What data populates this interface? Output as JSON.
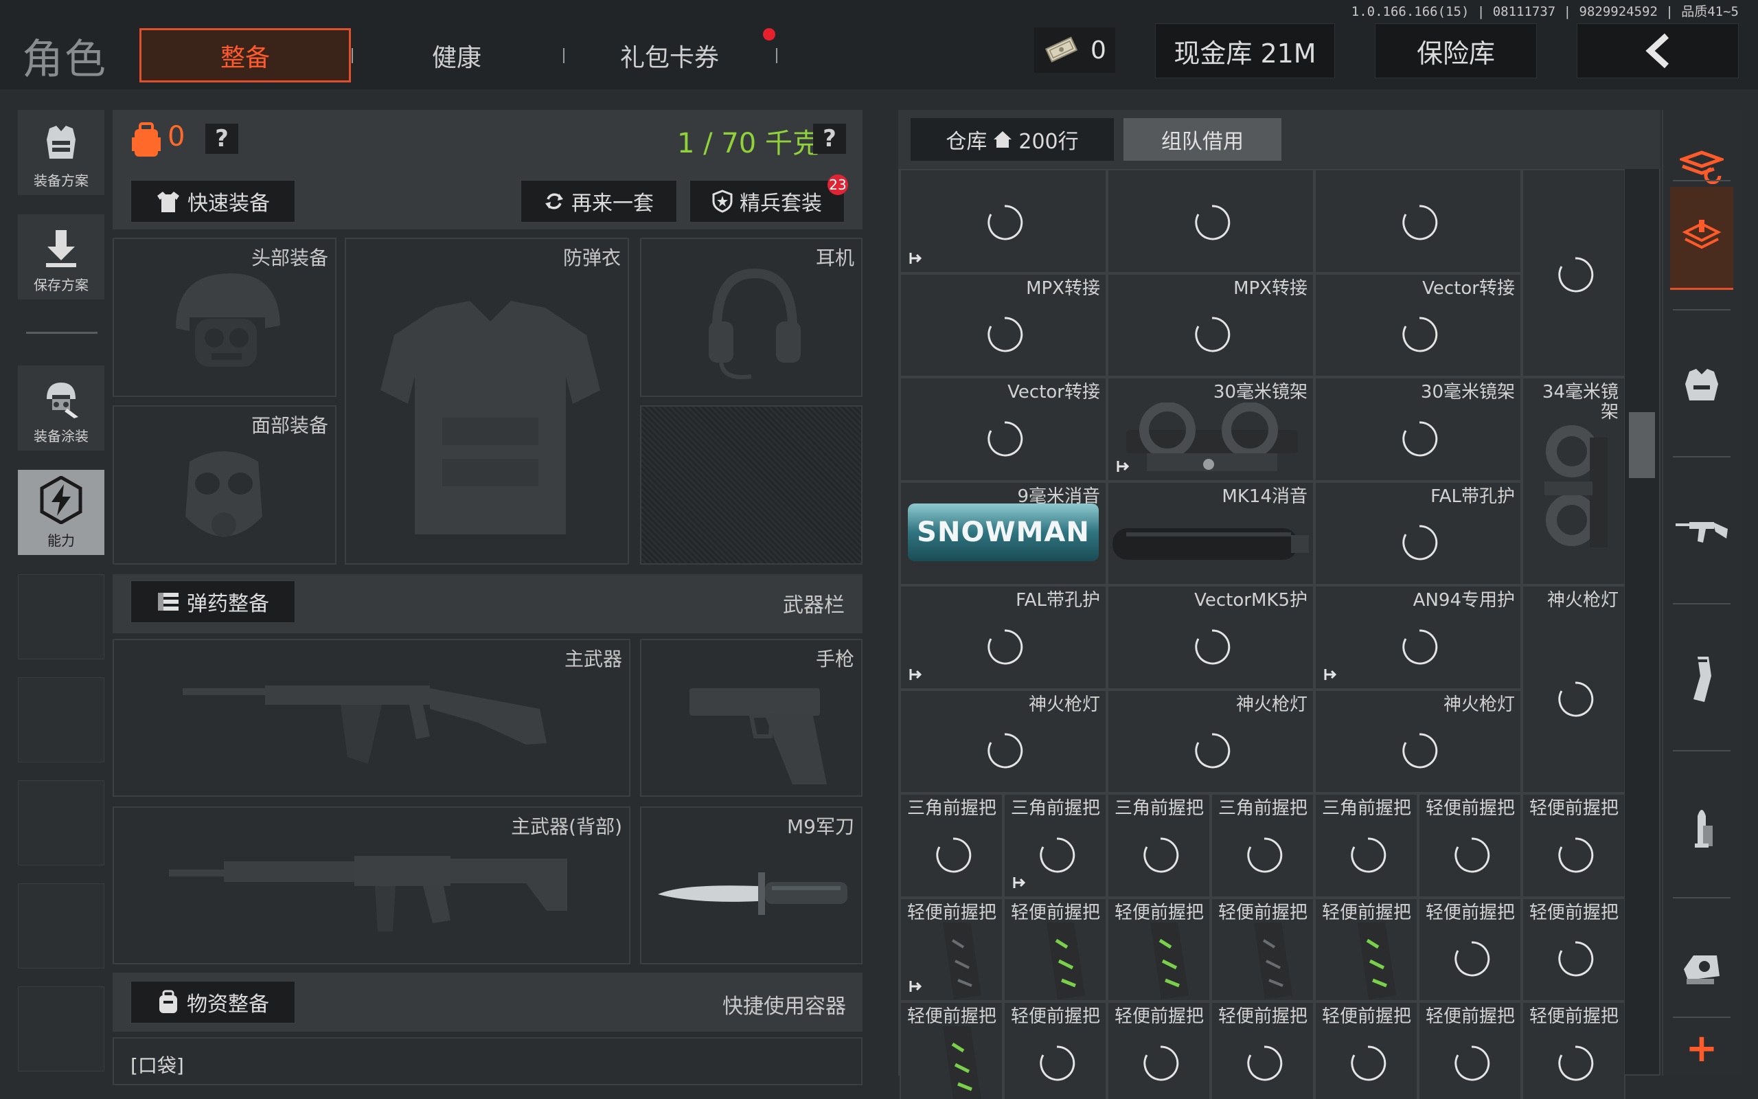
{
  "version": "1.0.166.166(15) | 08111737 | 9829924592 | 品质41~5",
  "header": {
    "title": "角色",
    "tabs": [
      {
        "label": "整备",
        "active": true
      },
      {
        "label": "健康",
        "active": false
      },
      {
        "label": "礼包卡券",
        "active": false
      }
    ],
    "coins": "0",
    "cash_vault": "现金库 21M",
    "safe_box": "保险库"
  },
  "sidebar": {
    "items": [
      {
        "label": "装备方案",
        "icon": "vest-plan-icon"
      },
      {
        "label": "保存方案",
        "icon": "download-icon"
      },
      {
        "label": "装备涂装",
        "icon": "helmet-skin-icon"
      },
      {
        "label": "能力",
        "icon": "ability-icon"
      }
    ]
  },
  "equip": {
    "bag_count": "0",
    "weight": "1 / 70 千克",
    "help": "?",
    "quick_equip": "快速装备",
    "again": "再来一套",
    "elite": "精兵套装",
    "elite_badge": "23",
    "slots": {
      "head": "头部装备",
      "vest": "防弹衣",
      "ear": "耳机",
      "face": "面部装备",
      "primary": "主武器",
      "pistol": "手枪",
      "back": "主武器(背部)",
      "knife": "M9军刀"
    },
    "ammo": "弹药整备",
    "weapon_bar": "武器栏",
    "supply": "物资整备",
    "quick_container": "快捷使用容器",
    "pocket": "[口袋]"
  },
  "warehouse": {
    "tab": "仓库",
    "rows": "200行",
    "team_borrow": "组队借用",
    "items": [
      {
        "label": "",
        "c": 0,
        "r": 0,
        "w": 2,
        "h": 1,
        "exp": true
      },
      {
        "label": "",
        "c": 2,
        "r": 0,
        "w": 2,
        "h": 1
      },
      {
        "label": "",
        "c": 4,
        "r": 0,
        "w": 2,
        "h": 1
      },
      {
        "label": "",
        "c": 6,
        "r": 0,
        "w": 1,
        "h": 2
      },
      {
        "label": "MPX转接",
        "c": 0,
        "r": 1,
        "w": 2,
        "h": 1
      },
      {
        "label": "MPX转接",
        "c": 2,
        "r": 1,
        "w": 2,
        "h": 1
      },
      {
        "label": "Vector转接",
        "c": 4,
        "r": 1,
        "w": 2,
        "h": 1
      },
      {
        "label": "Vector转接",
        "c": 0,
        "r": 2,
        "w": 2,
        "h": 1
      },
      {
        "label": "30毫米镜架",
        "c": 2,
        "r": 2,
        "w": 2,
        "h": 1,
        "img": "mount",
        "exp": true
      },
      {
        "label": "30毫米镜架",
        "c": 4,
        "r": 2,
        "w": 2,
        "h": 1
      },
      {
        "label": "34毫米镜\n架",
        "c": 6,
        "r": 2,
        "w": 1,
        "h": 2,
        "img": "mount34"
      },
      {
        "label": "9毫米消音",
        "c": 0,
        "r": 3,
        "w": 2,
        "h": 1,
        "img": "snowman",
        "snowman": "SNOWMAN"
      },
      {
        "label": "MK14消音",
        "c": 2,
        "r": 3,
        "w": 2,
        "h": 1,
        "img": "suppressor"
      },
      {
        "label": "FAL带孔护",
        "c": 4,
        "r": 3,
        "w": 2,
        "h": 1
      },
      {
        "label": "FAL带孔护",
        "c": 0,
        "r": 4,
        "w": 2,
        "h": 1,
        "exp": true
      },
      {
        "label": "VectorMK5护",
        "c": 2,
        "r": 4,
        "w": 2,
        "h": 1
      },
      {
        "label": "AN94专用护",
        "c": 4,
        "r": 4,
        "w": 2,
        "h": 1,
        "exp": true
      },
      {
        "label": "神火枪灯",
        "c": 6,
        "r": 4,
        "w": 1,
        "h": 2
      },
      {
        "label": "神火枪灯",
        "c": 0,
        "r": 5,
        "w": 2,
        "h": 1
      },
      {
        "label": "神火枪灯",
        "c": 2,
        "r": 5,
        "w": 2,
        "h": 1
      },
      {
        "label": "神火枪灯",
        "c": 4,
        "r": 5,
        "w": 2,
        "h": 1
      },
      {
        "label": "三角前握把",
        "c": 0,
        "r": 6,
        "w": 1,
        "h": 1
      },
      {
        "label": "三角前握把",
        "c": 1,
        "r": 6,
        "w": 1,
        "h": 1,
        "exp": true
      },
      {
        "label": "三角前握把",
        "c": 2,
        "r": 6,
        "w": 1,
        "h": 1
      },
      {
        "label": "三角前握把",
        "c": 3,
        "r": 6,
        "w": 1,
        "h": 1
      },
      {
        "label": "三角前握把",
        "c": 4,
        "r": 6,
        "w": 1,
        "h": 1
      },
      {
        "label": "轻便前握把",
        "c": 5,
        "r": 6,
        "w": 1,
        "h": 1
      },
      {
        "label": "轻便前握把",
        "c": 6,
        "r": 6,
        "w": 1,
        "h": 1
      },
      {
        "label": "轻便前握把",
        "c": 0,
        "r": 7,
        "w": 1,
        "h": 1,
        "img": "grip",
        "exp": true
      },
      {
        "label": "轻便前握把",
        "c": 1,
        "r": 7,
        "w": 1,
        "h": 1,
        "img": "gripg"
      },
      {
        "label": "轻便前握把",
        "c": 2,
        "r": 7,
        "w": 1,
        "h": 1,
        "img": "gripg"
      },
      {
        "label": "轻便前握把",
        "c": 3,
        "r": 7,
        "w": 1,
        "h": 1,
        "img": "grip"
      },
      {
        "label": "轻便前握把",
        "c": 4,
        "r": 7,
        "w": 1,
        "h": 1,
        "img": "gripg"
      },
      {
        "label": "轻便前握把",
        "c": 5,
        "r": 7,
        "w": 1,
        "h": 1
      },
      {
        "label": "轻便前握把",
        "c": 6,
        "r": 7,
        "w": 1,
        "h": 1
      },
      {
        "label": "轻便前握把",
        "c": 0,
        "r": 8,
        "w": 1,
        "h": 1,
        "img": "gripg"
      },
      {
        "label": "轻便前握把",
        "c": 1,
        "r": 8,
        "w": 1,
        "h": 1
      },
      {
        "label": "轻便前握把",
        "c": 2,
        "r": 8,
        "w": 1,
        "h": 1
      },
      {
        "label": "轻便前握把",
        "c": 3,
        "r": 8,
        "w": 1,
        "h": 1
      },
      {
        "label": "轻便前握把",
        "c": 4,
        "r": 8,
        "w": 1,
        "h": 1
      },
      {
        "label": "轻便前握把",
        "c": 5,
        "r": 8,
        "w": 1,
        "h": 1
      },
      {
        "label": "轻便前握把",
        "c": 6,
        "r": 8,
        "w": 1,
        "h": 1
      }
    ]
  },
  "right_strip": {
    "items": [
      "storage-stack-icon",
      "storage-layers-icon",
      "armor-icon",
      "rifle-icon",
      "magazine-icon",
      "bullet-icon",
      "sight-icon",
      "plus-icon"
    ],
    "add": "+"
  },
  "colors": {
    "accent": "#e1502a",
    "weight_green": "#8fd23a",
    "badge_red": "#e02434"
  }
}
